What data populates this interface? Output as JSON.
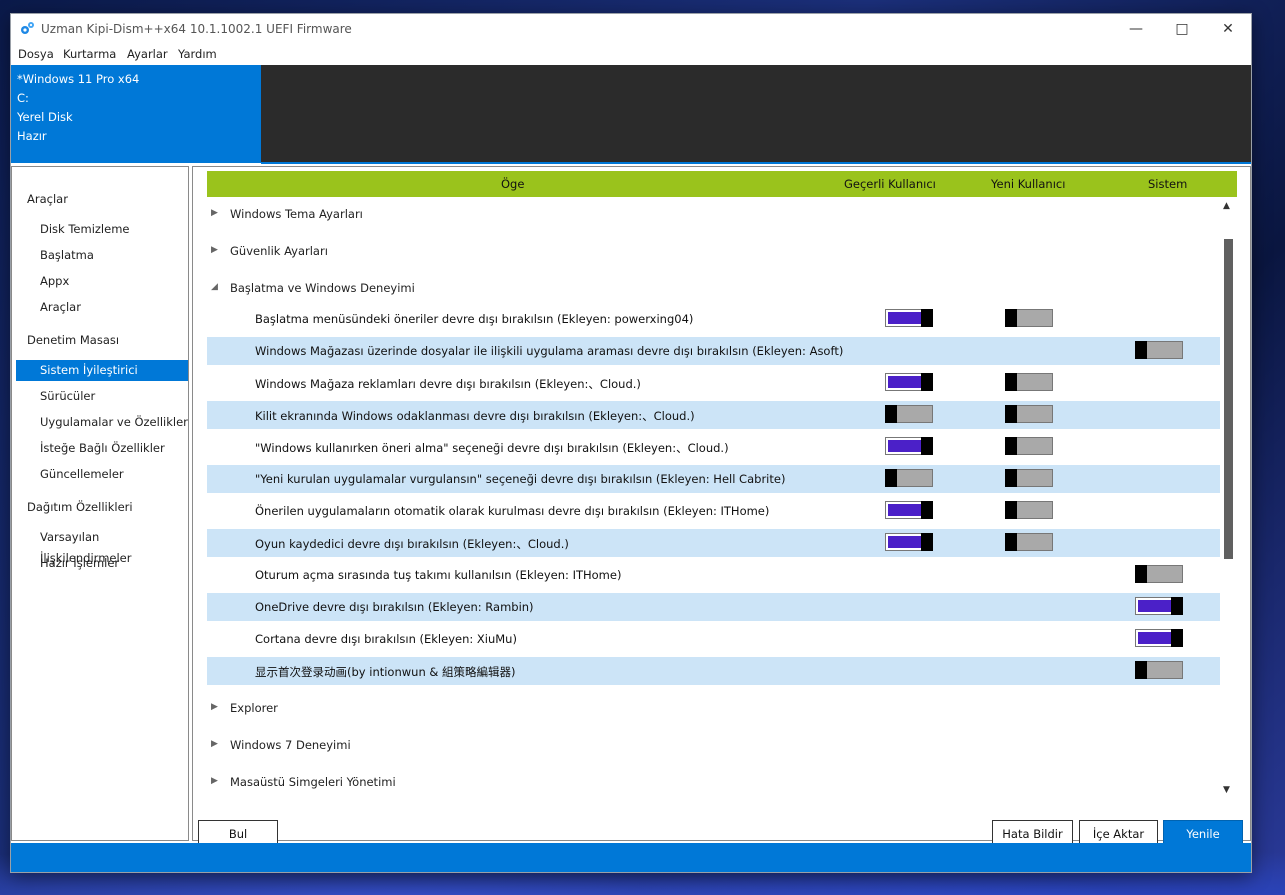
{
  "window": {
    "title": "Uzman Kipi-Dism++x64 10.1.1002.1 UEFI Firmware"
  },
  "menu": [
    "Dosya",
    "Kurtarma",
    "Ayarlar",
    "Yardım"
  ],
  "info": {
    "lines": [
      "*Windows 11 Pro x64",
      "C:",
      "Yerel Disk",
      "Hazır"
    ]
  },
  "sidebar": {
    "sections": [
      {
        "title": "Araçlar",
        "items": [
          "Disk Temizleme",
          "Başlatma",
          "Appx",
          "Araçlar"
        ]
      },
      {
        "title": "Denetim Masası",
        "items": [
          "Sistem İyileştirici",
          "Sürücüler",
          "Uygulamalar ve Özellikler",
          "İsteğe Bağlı Özellikler",
          "Güncellemeler"
        ]
      },
      {
        "title": "Dağıtım Özellikleri",
        "items": [
          "Varsayılan İlişkilendirmeler",
          "Hazır İşlemler"
        ]
      }
    ],
    "active_item": "Sistem İyileştirici"
  },
  "table": {
    "headers": {
      "item": "Öge",
      "current_user": "Geçerli Kullanıcı",
      "new_user": "Yeni Kullanıcı",
      "system": "Sistem"
    },
    "groups_before": [
      "Windows Tema Ayarları",
      "Güvenlik Ayarları"
    ],
    "expanded_group": "Başlatma ve Windows Deneyimi",
    "rows": [
      {
        "label": "Başlatma menüsündeki öneriler devre dışı bırakılsın (Ekleyen: powerxing04)",
        "current": "on",
        "new": "off",
        "system": null
      },
      {
        "label": "Windows Mağazası üzerinde dosyalar ile ilişkili uygulama araması devre dışı bırakılsın (Ekleyen: Asoft)",
        "current": null,
        "new": null,
        "system": "off"
      },
      {
        "label": "Windows Mağaza reklamları devre dışı bırakılsın (Ekleyen:、Cloud.)",
        "current": "on",
        "new": "off",
        "system": null
      },
      {
        "label": "Kilit ekranında Windows odaklanması devre dışı bırakılsın (Ekleyen:、Cloud.)",
        "current": "off",
        "new": "off",
        "system": null
      },
      {
        "label": "\"Windows kullanırken öneri alma\" seçeneği devre dışı bırakılsın (Ekleyen:、Cloud.)",
        "current": "on",
        "new": "off",
        "system": null
      },
      {
        "label": "\"Yeni kurulan uygulamalar vurgulansın\" seçeneği devre dışı bırakılsın (Ekleyen: Hell Cabrite)",
        "current": "off",
        "new": "off",
        "system": null
      },
      {
        "label": "Önerilen uygulamaların otomatik olarak kurulması devre dışı bırakılsın (Ekleyen: ITHome)",
        "current": "on",
        "new": "off",
        "system": null
      },
      {
        "label": "Oyun kaydedici devre dışı bırakılsın (Ekleyen:、Cloud.)",
        "current": "on",
        "new": "off",
        "system": null
      },
      {
        "label": "Oturum açma sırasında tuş takımı kullanılsın (Ekleyen: ITHome)",
        "current": null,
        "new": null,
        "system": "off"
      },
      {
        "label": "OneDrive devre dışı bırakılsın (Ekleyen: Rambin)",
        "current": null,
        "new": null,
        "system": "on"
      },
      {
        "label": "Cortana devre dışı bırakılsın (Ekleyen: XiuMu)",
        "current": null,
        "new": null,
        "system": "on"
      },
      {
        "label": "显示首次登录动画(by intionwun & 組策略編辑器)",
        "current": null,
        "new": null,
        "system": "off"
      }
    ],
    "groups_after": [
      "Explorer",
      "Windows 7 Deneyimi",
      "Masaüstü Simgeleri Yönetimi"
    ]
  },
  "buttons": {
    "find": "Bul",
    "report": "Hata Bildir",
    "import": "İçe Aktar",
    "refresh": "Yenile"
  },
  "colors": {
    "accent": "#0078d7",
    "header": "#9ac31c",
    "toggle_on": "#4b20c8",
    "row_alt": "#cce4f7"
  }
}
